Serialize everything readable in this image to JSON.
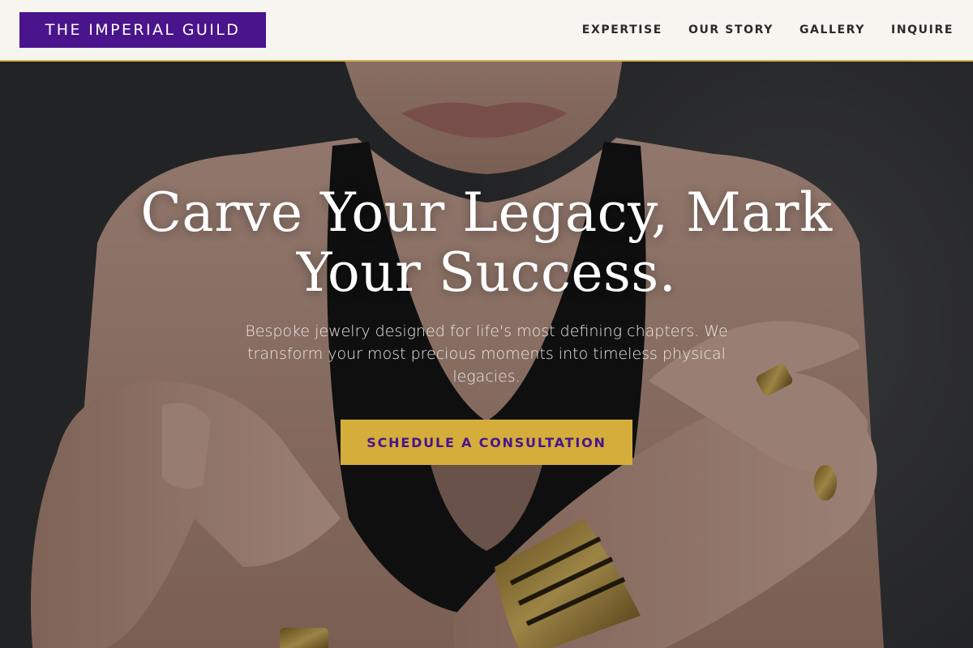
{
  "nav": {
    "brand": "THE IMPERIAL GUILD",
    "links": [
      "EXPERTISE",
      "OUR STORY",
      "GALLERY",
      "INQUIRE"
    ]
  },
  "hero": {
    "headline": "Carve Your Legacy, Mark Your Success.",
    "subtext": "Bespoke jewelry designed for life's most defining chapters. We transform your most precious moments into timeless physical legacies.",
    "cta_label": "SCHEDULE A CONSULTATION"
  },
  "colors": {
    "brand_purple": "#4a148c",
    "gold_accent": "#d4ad3a",
    "nav_background": "#f7f5ef"
  }
}
